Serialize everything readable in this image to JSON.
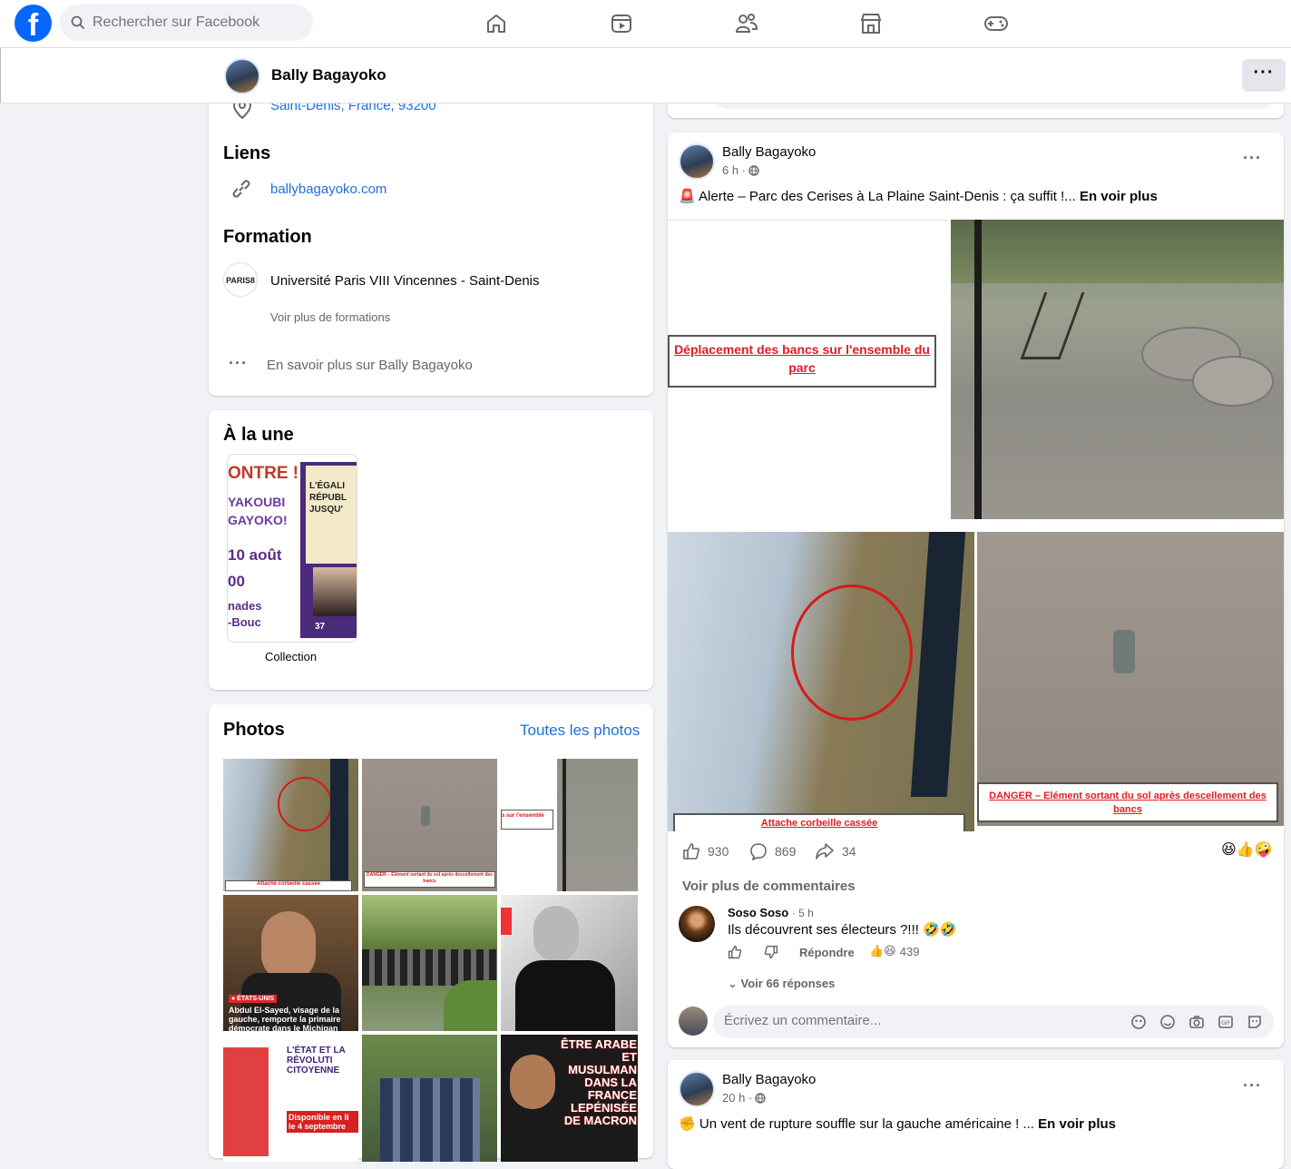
{
  "search": {
    "placeholder": "Rechercher sur Facebook"
  },
  "nav": [
    "home-icon",
    "video-icon",
    "friends-icon",
    "marketplace-icon",
    "gaming-icon"
  ],
  "profile": {
    "name": "Bally Bagayoko"
  },
  "intro": {
    "location": "Saint-Denis, France, 93200",
    "links_title": "Liens",
    "website": "ballybagayoko.com",
    "education_title": "Formation",
    "school": "Université Paris VIII Vincennes - Saint-Denis",
    "school_logo_text": "PARIS8",
    "more_education": "Voir plus de formations",
    "about_more": "En savoir plus sur Bally Bagayoko"
  },
  "featured": {
    "title": "À la une",
    "collection_label": "Collection",
    "cover_lines": [
      "ONTRE !",
      "YAKOUBI",
      "GAYOKO!",
      "10 août",
      "00",
      "nades",
      "-Bouc"
    ],
    "cover_right": [
      "L'ÉGALI",
      "RÉPUBL",
      "JUSQU'"
    ],
    "cover_badge": "37"
  },
  "photos": {
    "title": "Photos",
    "all_link": "Toutes les photos",
    "captions": {
      "p1": "Attache corbeille cassée",
      "p2": "DANGER – Elément sortant du sol après descellement des bancs",
      "p3": "s sur l'ensemble",
      "p4_tag": "● ÉTATS-UNIS",
      "p4": "Abdul El-Sayed, visage de la gauche, remporte la primaire démocrate dans le Michigan",
      "p7a": "L'ÉTAT ET LA RÉVOLUTI CITOYENNE",
      "p7b": "Disponible en li le 4 septembre",
      "p9": "ÊTRE ARABE ET MUSULMAN DANS LA FRANCE LEPÉNISÉE DE MACRON"
    }
  },
  "post1": {
    "author": "Bally Bagayoko",
    "time": "6 h ·",
    "emoji": "🚨",
    "text": "Alerte – Parc des Cerises à La Plaine Saint-Denis : ça suffit !...",
    "see_more": "En voir plus",
    "img_label1": "Déplacement des bancs sur l'ensemble du parc",
    "img_label2": "Attache corbeille cassée",
    "img_label3": "DANGER – Elément sortant du sol après descellement des bancs",
    "likes": "930",
    "comments": "869",
    "shares": "34",
    "reactions": "😆👍🤪",
    "more_comments": "Voir plus de commentaires",
    "comment": {
      "author": "Soso Soso",
      "time": "· 5 h",
      "text": "Ils découvrent ses électeurs ?!!! 🤣🤣",
      "reply": "Répondre",
      "reactions": "👍😆",
      "count": "439",
      "replies": "Voir 66 réponses"
    },
    "write_placeholder": "Écrivez un commentaire..."
  },
  "post2": {
    "author": "Bally Bagayoko",
    "time": "20 h ·",
    "emoji": "✊",
    "text": "Un vent de rupture souffle sur la gauche américaine ! ...",
    "see_more": "En voir plus"
  }
}
